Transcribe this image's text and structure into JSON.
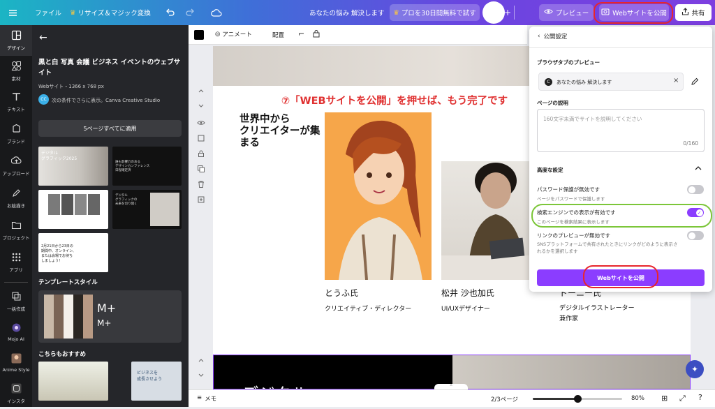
{
  "topbar": {
    "menu_icon": "hamburger-icon",
    "file_label": "ファイル",
    "resize_label": "リサイズ＆マジック変換",
    "doc_title": "あなたの悩み 解決します",
    "pro_trial_label": "プロを30日間無料で試す",
    "preview_label": "プレビュー",
    "publish_label": "Webサイトを公開",
    "share_label": "共有"
  },
  "rail": {
    "items": [
      {
        "label": "デザイン",
        "icon": "design-icon"
      },
      {
        "label": "素材",
        "icon": "elements-icon"
      },
      {
        "label": "テキスト",
        "icon": "text-icon"
      },
      {
        "label": "ブランド",
        "icon": "brand-icon"
      },
      {
        "label": "アップロード",
        "icon": "upload-icon"
      },
      {
        "label": "お絵描き",
        "icon": "draw-icon"
      },
      {
        "label": "プロジェクト",
        "icon": "folder-icon"
      },
      {
        "label": "アプリ",
        "icon": "apps-icon"
      },
      {
        "label": "一括作成",
        "icon": "bulk-create-icon"
      },
      {
        "label": "Mojo AI",
        "icon": "mojo-ai-icon"
      },
      {
        "label": "Anime Style",
        "icon": "anime-style-icon"
      },
      {
        "label": "インスタ",
        "icon": "insta-icon"
      }
    ]
  },
  "panel": {
    "title": "黒と白 写真 会議 ビジネス イベントのウェブサイト",
    "meta": "Webサイト・1366 x 768 px",
    "creator_badge": "CC",
    "creator_text": "次の条件でさらに表示。Canva Creative Studio",
    "apply_all_button": "5ページすべてに適用",
    "thumb1_text": "デジタル\nグラフィック2025",
    "thumb2_text": "誰も影響力のある\nデザインカンファレンス\n日程確定済",
    "thumb4_text": "デジタル\nグラフィックの\n未来を切り開く",
    "thumb5_text": "2月21日から23日の\n期間中、オンライン、\nまたは会場でお待ち\nしましょう！",
    "template_style_heading": "テンプレートスタイル",
    "font_sample_big": "M+",
    "font_sample_small": "M+",
    "palette": [
      "#c9b9a8",
      "#7a6455",
      "#f4f0ea",
      "#2a2622",
      "#b89a84"
    ],
    "recommend_heading": "こちらもおすすめ",
    "rec2_text": "ビジネスを\n成長させよう"
  },
  "toolbar": {
    "animate_label": "アニメート",
    "arrange_label": "配置"
  },
  "canvas": {
    "headline": "⑦「WEBサイトを公開」を押せば、もう完了です",
    "intro": "世界中から\nクリエイターが集まる",
    "person1_name": "とうふ氏",
    "person1_role": "クリエイティブ・ディレクター",
    "person2_name": "松井 沙也加氏",
    "person2_role": "UI/UXデザイナー",
    "person3_name": "ドーニー氏",
    "person3_role": "デジタルイラストレーター\n兼作家",
    "banner_text": "デジタル"
  },
  "publish_panel": {
    "back_label": "公開設定",
    "browser_tab_label": "ブラウザタブのプレビュー",
    "tab_favicon": "C",
    "tab_title": "あなたの悩み 解決します",
    "description_label": "ページの説明",
    "description_placeholder": "160文字未満でサイトを説明してください",
    "description_count": "0/160",
    "advanced_label": "高度な設定",
    "password_title": "パスワード保護が無効です",
    "password_sub": "ページをパスワードで保護します",
    "password_enabled": false,
    "search_title": "検索エンジンでの表示が有効です",
    "search_sub": "このページを検索結果に表示します",
    "search_enabled": true,
    "link_title": "リンクのプレビューが無効です",
    "link_sub": "SNSプラットフォームで共有されたときにリンクがどのように表示されるかを選択します",
    "link_enabled": false,
    "publish_button": "Webサイトを公開"
  },
  "bottombar": {
    "notes_label": "メモ",
    "page_indicator": "2/3ページ",
    "zoom_value": "80%",
    "zoom_fraction": 0.5
  },
  "colors": {
    "accent_purple": "#8b3dff",
    "headline_red": "#e03131",
    "highlight_green": "#7cc639",
    "annotation_red": "#e8262c"
  }
}
